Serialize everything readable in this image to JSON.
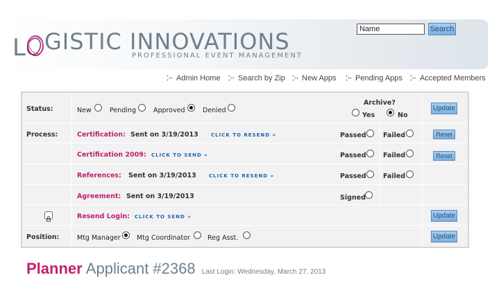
{
  "brand": {
    "name": "LOGISTIC INNOVATIONS",
    "name_part1": "L",
    "name_part2": "GISTIC INNOVATIONS",
    "tagline": "PROFESSIONAL EVENT MANAGEMENT"
  },
  "search": {
    "value": "Name",
    "button_label": "Search"
  },
  "nav": {
    "items": [
      {
        "label": "Admin Home"
      },
      {
        "label": "Search by Zip"
      },
      {
        "label": "New Apps"
      },
      {
        "label": "Pending Apps"
      },
      {
        "label": "Accepted Members"
      }
    ]
  },
  "panel": {
    "status": {
      "label": "Status:",
      "options": [
        {
          "label": "New",
          "checked": false
        },
        {
          "label": "Pending",
          "checked": false
        },
        {
          "label": "Approved",
          "checked": true
        },
        {
          "label": "Denied",
          "checked": false
        }
      ],
      "archive_label": "Archive?",
      "archive_yes": "Yes",
      "archive_no": "No",
      "archive_value": "No",
      "update_label": "Update"
    },
    "process": {
      "label": "Process:",
      "rows": [
        {
          "name": "Certification:",
          "sent": "Sent on 3/19/2013",
          "action": "CLICK TO RESEND »",
          "passed": "Passed",
          "failed": "Failed",
          "reset": "Reset"
        },
        {
          "name": "Certification 2009:",
          "sent": "",
          "action": "CLICK TO SEND »",
          "passed": "Passed",
          "failed": "Failed",
          "reset": "Reset"
        },
        {
          "name": "References:",
          "sent": "Sent on 3/19/2013",
          "action": "CLICK TO RESEND »",
          "passed": "Passed",
          "failed": "Failed"
        },
        {
          "name": "Agreement:",
          "sent": "Sent on 3/19/2013",
          "signed": "Signed"
        }
      ]
    },
    "resend_login": {
      "name": "Resend Login:",
      "action": "CLICK TO SEND »",
      "update_label": "Update"
    },
    "position": {
      "label": "Position:",
      "options": [
        {
          "label": "Mtg Manager",
          "checked": true
        },
        {
          "label": "Mtg Coordinator",
          "checked": false
        },
        {
          "label": "Reg Asst.",
          "checked": false
        }
      ],
      "update_label": "Update"
    }
  },
  "title": {
    "role": "Planner",
    "applicant": "Applicant #2368",
    "last_login": "Last Login: Wednesday, March 27, 2013"
  },
  "colors": {
    "accent": "#c0206d",
    "brand_gray": "#6f7f8c",
    "button": "#7fb0e0",
    "link": "#1b64b0"
  }
}
